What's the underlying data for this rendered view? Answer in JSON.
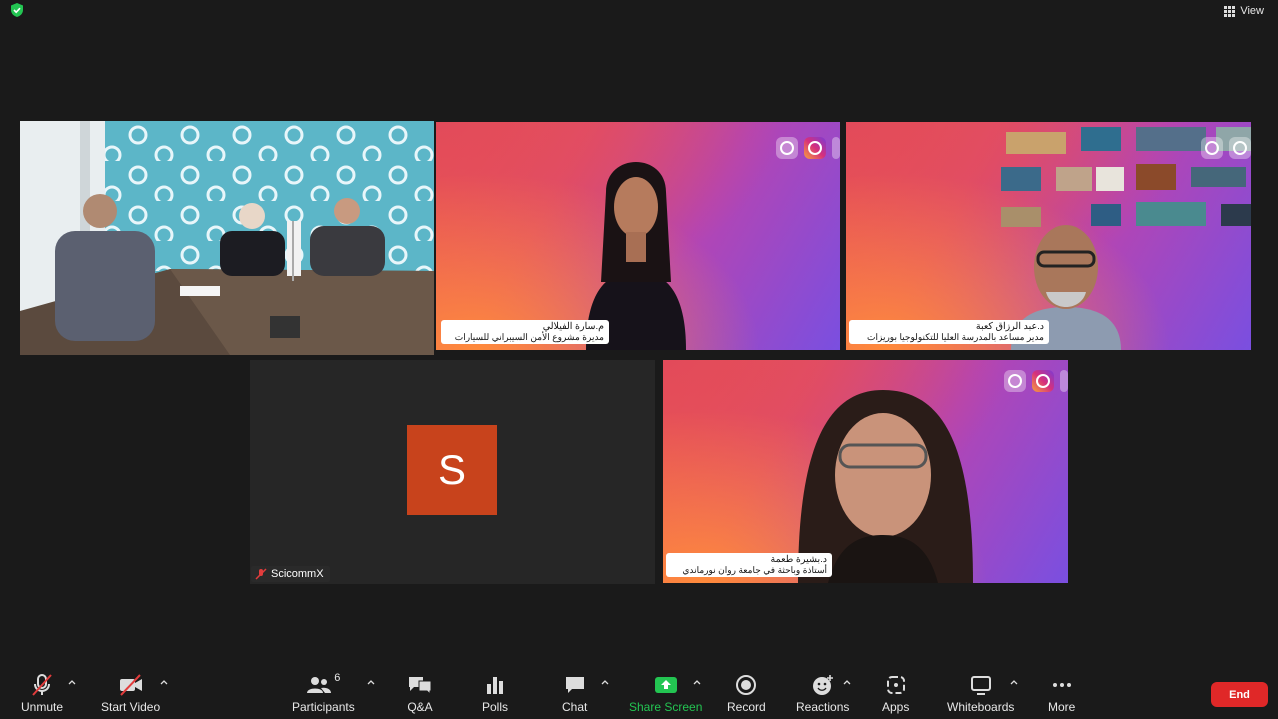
{
  "top_bar": {
    "view_label": "View",
    "shield_color": "#23c552"
  },
  "tiles": [
    {
      "id": "room",
      "active": true,
      "border_color": "#8ad12b"
    },
    {
      "id": "sara",
      "name": "م.سارة الفيلالي",
      "title": "مديرة مشروع الأمن السيبراني للسيارات"
    },
    {
      "id": "abderrazak",
      "name": "د.عبد الرزاق كعبة",
      "title": "مدير مساعد بالمدرسة العليا للتكنولوجيا بوريزات"
    },
    {
      "id": "scicommx",
      "avatar_letter": "S",
      "name": "ScicommX",
      "avatar_color": "#c8431c"
    },
    {
      "id": "bouchra",
      "name": "د.بشيرة طعمة",
      "title": "أستاذة وباحثة في جامعة روان نورماندي"
    }
  ],
  "toolbar": {
    "unmute": "Unmute",
    "start_video": "Start Video",
    "participants": "Participants",
    "participants_count": "6",
    "qa": "Q&A",
    "polls": "Polls",
    "chat": "Chat",
    "share_screen": "Share Screen",
    "record": "Record",
    "reactions": "Reactions",
    "apps": "Apps",
    "whiteboards": "Whiteboards",
    "more": "More",
    "end": "End",
    "share_color": "#23c552",
    "end_color": "#e02828"
  }
}
